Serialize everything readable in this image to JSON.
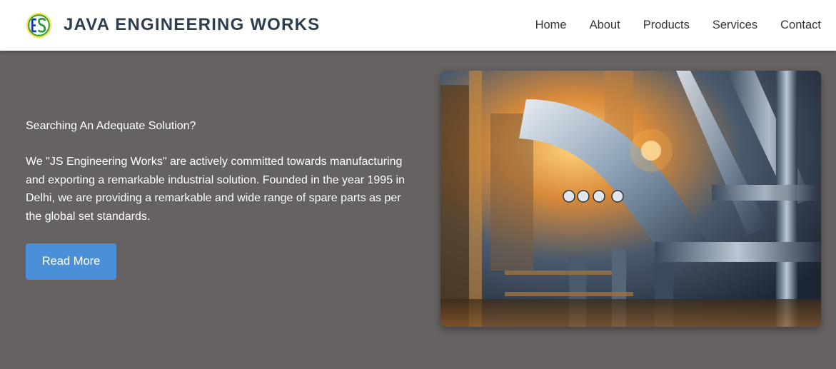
{
  "brand": {
    "name": "JAVA ENGINEERING WORKS",
    "logo_text": "JS",
    "logo_icon": "company-logo-icon"
  },
  "nav": {
    "items": [
      {
        "label": "Home"
      },
      {
        "label": "About"
      },
      {
        "label": "Products"
      },
      {
        "label": "Services"
      },
      {
        "label": "Contact"
      }
    ]
  },
  "hero": {
    "kicker": "Searching An Adequate Solution?",
    "description": "We \"JS Engineering Works\" are actively committed towards manufacturing and exporting a remarkable industrial solution. Founded in the year 1995 in Delhi, we are providing a remarkable and wide range of spare parts as per the global set standards.",
    "button_label": "Read More",
    "image_alt": "Industrial pipes and machinery"
  },
  "colors": {
    "background": "#666262",
    "navbar": "#ffffff",
    "brand_text": "#2c3e50",
    "button": "#4a90d9"
  }
}
